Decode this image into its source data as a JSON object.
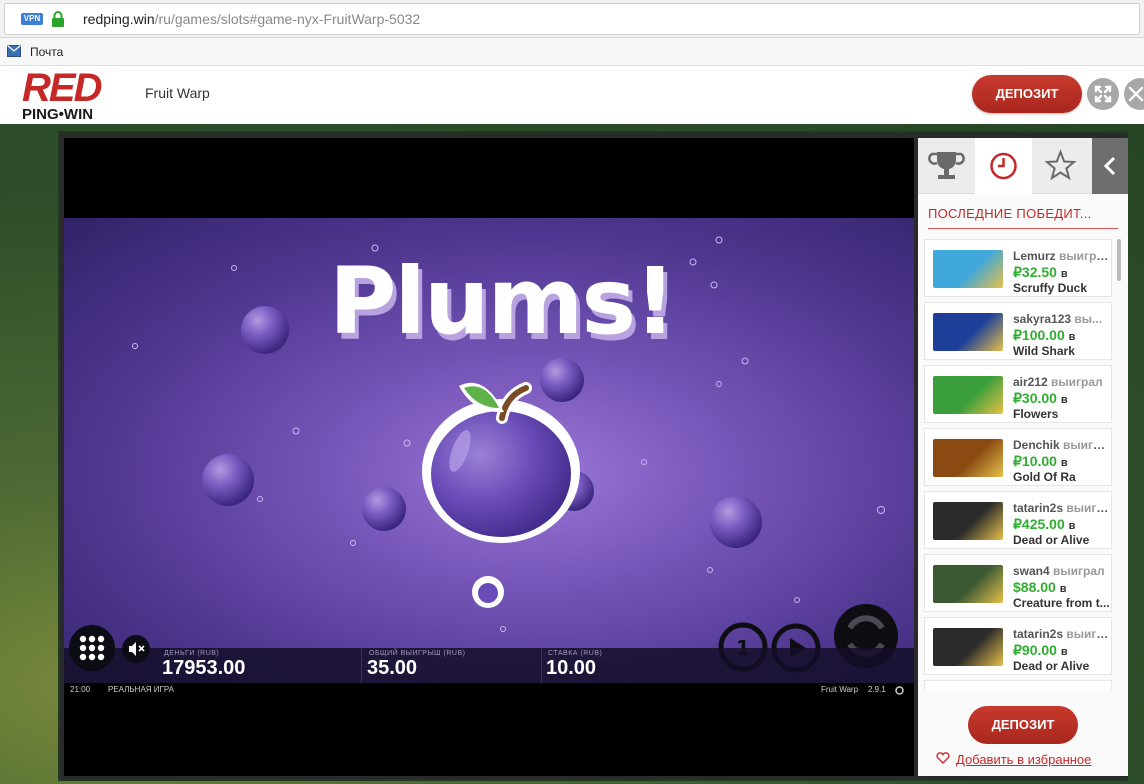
{
  "browser": {
    "vpn_label": "VPN",
    "url_host": "redping.win",
    "url_path": "/ru/games/slots#game-nyx-FruitWarp-5032",
    "bookmark_label": "Почта"
  },
  "header": {
    "logo_main": "RED",
    "logo_sub": "PING•WIN",
    "game_title": "Fruit Warp",
    "deposit_label": "ДЕПОЗИТ"
  },
  "game": {
    "banner": "Plums!",
    "hud": {
      "money_label": "ДЕНЬГИ (RUB)",
      "money_value": "17953.00",
      "win_label": "ОБЩИЙ ВЫИГРЫШ (RUB)",
      "win_value": "35.00",
      "bet_label": "СТАВКА (RUB)",
      "bet_value": "10.00"
    },
    "clock": "21:00",
    "mode": "РЕАЛЬНАЯ ИГРА",
    "footer_game": "Fruit Warp",
    "version": "2.9.1"
  },
  "panel": {
    "heading": "ПОСЛЕДНИЕ ПОБЕДИТ...",
    "winners": [
      {
        "user": "Lemurz",
        "verb": "выиграл",
        "amount": "₽32.50",
        "in": "в",
        "game": "Scruffy Duck",
        "thumb_color": "#3fa7d9"
      },
      {
        "user": "sakyra123",
        "verb": "вы...",
        "amount": "₽100.00",
        "in": "в",
        "game": "Wild Shark",
        "thumb_color": "#1d3f9a"
      },
      {
        "user": "air212",
        "verb": "выиграл",
        "amount": "₽30.00",
        "in": "в",
        "game": "Flowers",
        "thumb_color": "#3a9e3a"
      },
      {
        "user": "Denchik",
        "verb": "выиграл",
        "amount": "₽10.00",
        "in": "в",
        "game": "Gold Of Ra",
        "thumb_color": "#8a4a12"
      },
      {
        "user": "tatarin2s",
        "verb": "выигр...",
        "amount": "₽425.00",
        "in": "в",
        "game": "Dead or Alive",
        "thumb_color": "#2b2b2b"
      },
      {
        "user": "swan4",
        "verb": "выиграл",
        "amount": "$88.00",
        "in": "в",
        "game": "Creature from t...",
        "thumb_color": "#3b5a34"
      },
      {
        "user": "tatarin2s",
        "verb": "выигр...",
        "amount": "₽90.00",
        "in": "в",
        "game": "Dead or Alive",
        "thumb_color": "#2b2b2b"
      }
    ],
    "deposit_label": "ДЕПОЗИТ",
    "favorite_label": "Добавить в избранное"
  },
  "colors": {
    "brand_red": "#c62828",
    "win_green": "#2fae2f",
    "game_purple": "#5a3f9c"
  },
  "icons": [
    "lock-icon",
    "mail-icon",
    "expand-icon",
    "close-icon",
    "trophy-icon",
    "clock-icon",
    "star-icon",
    "chevron-left-icon",
    "menu-grid-icon",
    "mute-icon",
    "autoplay-icon",
    "spin-icon",
    "heart-icon"
  ]
}
